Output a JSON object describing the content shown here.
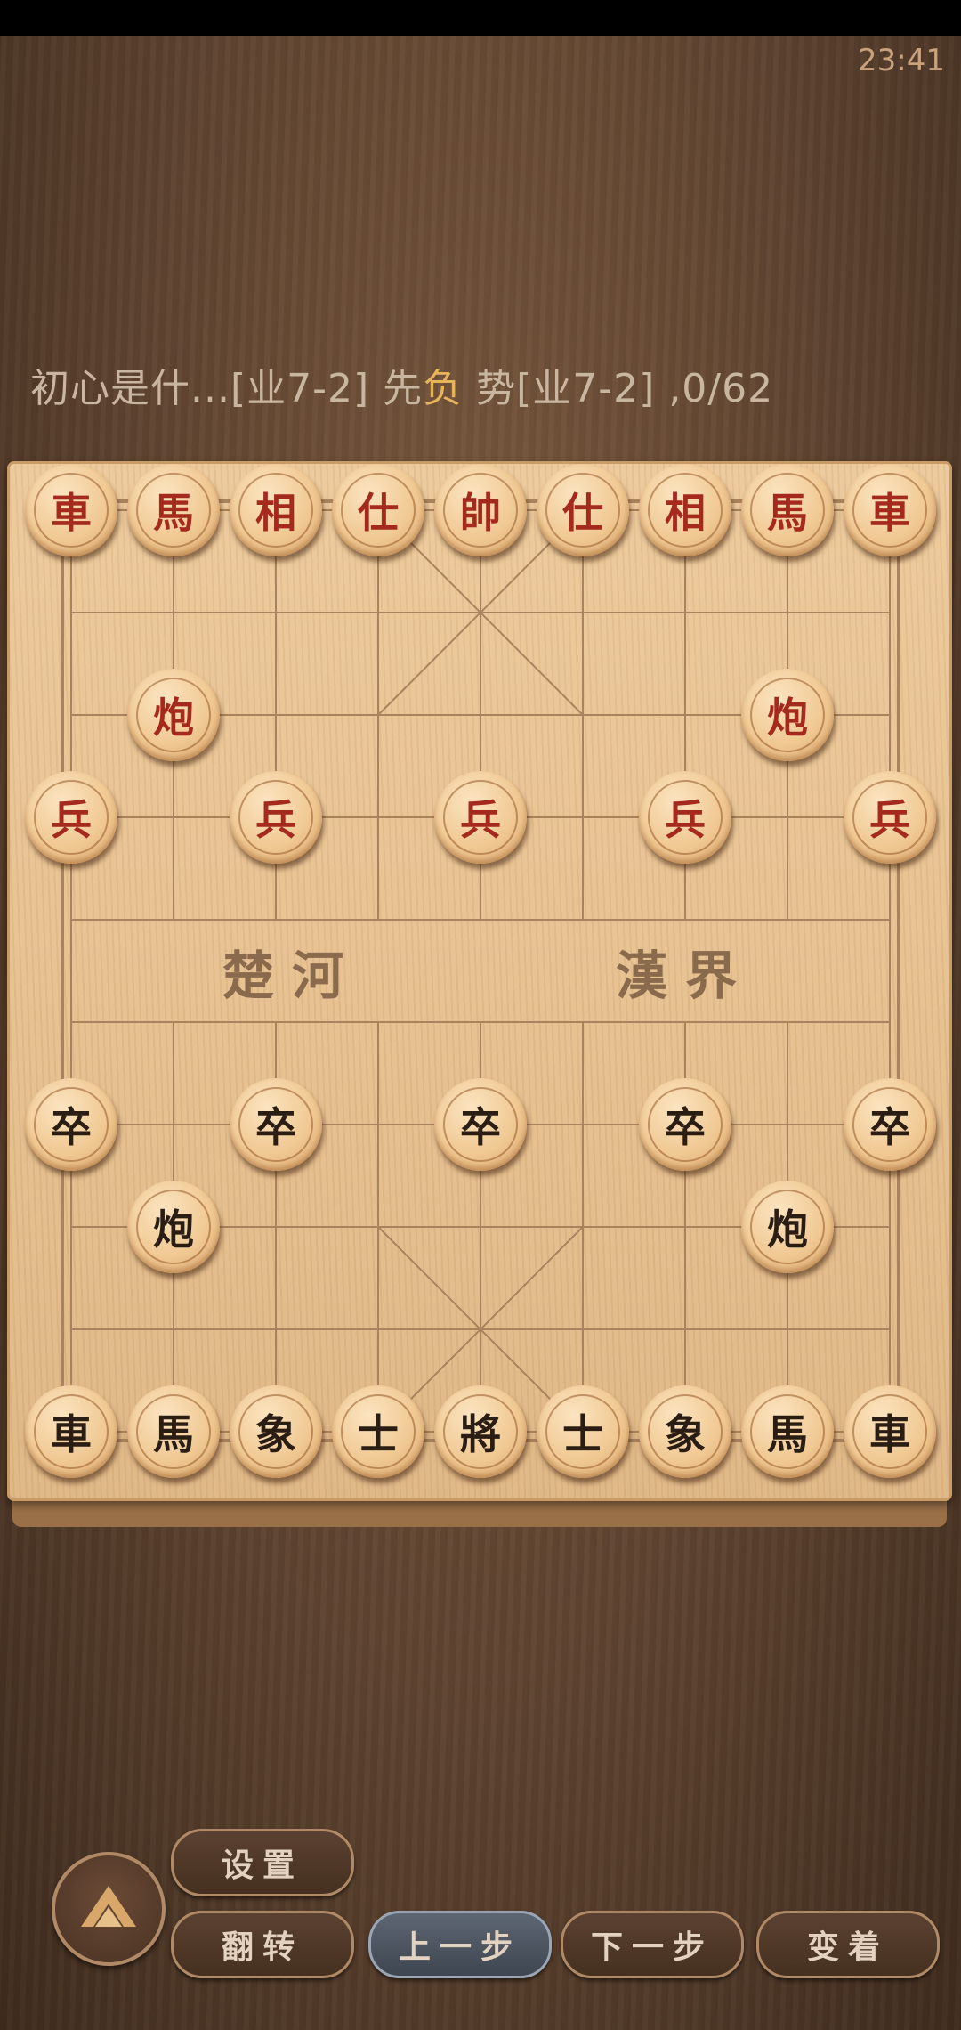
{
  "status": {
    "time": "23:41"
  },
  "game_info": {
    "prefix": "初心是什...[业7-2] 先",
    "result": "负",
    "suffix": " 势[业7-2] ,0/62"
  },
  "board": {
    "river_left": "楚 河",
    "river_right": "漢 界",
    "pieces": [
      {
        "label": "車",
        "side": "red",
        "file": 0,
        "rank": 0
      },
      {
        "label": "馬",
        "side": "red",
        "file": 1,
        "rank": 0
      },
      {
        "label": "相",
        "side": "red",
        "file": 2,
        "rank": 0
      },
      {
        "label": "仕",
        "side": "red",
        "file": 3,
        "rank": 0
      },
      {
        "label": "帥",
        "side": "red",
        "file": 4,
        "rank": 0
      },
      {
        "label": "仕",
        "side": "red",
        "file": 5,
        "rank": 0
      },
      {
        "label": "相",
        "side": "red",
        "file": 6,
        "rank": 0
      },
      {
        "label": "馬",
        "side": "red",
        "file": 7,
        "rank": 0
      },
      {
        "label": "車",
        "side": "red",
        "file": 8,
        "rank": 0
      },
      {
        "label": "炮",
        "side": "red",
        "file": 1,
        "rank": 2
      },
      {
        "label": "炮",
        "side": "red",
        "file": 7,
        "rank": 2
      },
      {
        "label": "兵",
        "side": "red",
        "file": 0,
        "rank": 3
      },
      {
        "label": "兵",
        "side": "red",
        "file": 2,
        "rank": 3
      },
      {
        "label": "兵",
        "side": "red",
        "file": 4,
        "rank": 3
      },
      {
        "label": "兵",
        "side": "red",
        "file": 6,
        "rank": 3
      },
      {
        "label": "兵",
        "side": "red",
        "file": 8,
        "rank": 3
      },
      {
        "label": "卒",
        "side": "black",
        "file": 0,
        "rank": 6
      },
      {
        "label": "卒",
        "side": "black",
        "file": 2,
        "rank": 6
      },
      {
        "label": "卒",
        "side": "black",
        "file": 4,
        "rank": 6
      },
      {
        "label": "卒",
        "side": "black",
        "file": 6,
        "rank": 6
      },
      {
        "label": "卒",
        "side": "black",
        "file": 8,
        "rank": 6
      },
      {
        "label": "炮",
        "side": "black",
        "file": 1,
        "rank": 7
      },
      {
        "label": "炮",
        "side": "black",
        "file": 7,
        "rank": 7
      },
      {
        "label": "車",
        "side": "black",
        "file": 0,
        "rank": 9
      },
      {
        "label": "馬",
        "side": "black",
        "file": 1,
        "rank": 9
      },
      {
        "label": "象",
        "side": "black",
        "file": 2,
        "rank": 9
      },
      {
        "label": "士",
        "side": "black",
        "file": 3,
        "rank": 9
      },
      {
        "label": "將",
        "side": "black",
        "file": 4,
        "rank": 9
      },
      {
        "label": "士",
        "side": "black",
        "file": 5,
        "rank": 9
      },
      {
        "label": "象",
        "side": "black",
        "file": 6,
        "rank": 9
      },
      {
        "label": "馬",
        "side": "black",
        "file": 7,
        "rank": 9
      },
      {
        "label": "車",
        "side": "black",
        "file": 8,
        "rank": 9
      }
    ]
  },
  "controls": {
    "settings": "设置",
    "flip": "翻转",
    "prev": "上一步",
    "next": "下一步",
    "variation": "变着",
    "home_icon": "home-arrow-icon"
  },
  "colors": {
    "red_piece_text": "#a52a1e",
    "black_piece_text": "#2a1d14",
    "highlight": "#e8b45a"
  }
}
